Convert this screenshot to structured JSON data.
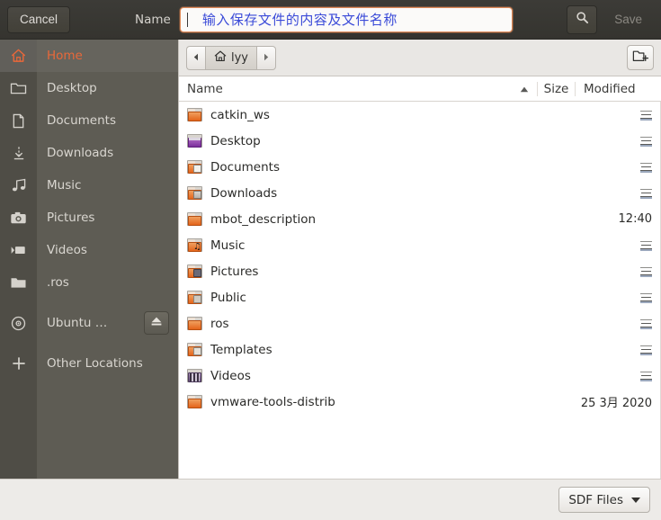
{
  "header": {
    "cancel_label": "Cancel",
    "name_label": "Name",
    "name_value": "",
    "name_annotation": "输入保存文件的内容及文件名称",
    "search_icon": "search-icon",
    "save_label": "Save",
    "save_enabled": false
  },
  "sidebar": {
    "items": [
      {
        "label": "Home",
        "icon": "home-icon",
        "selected": true
      },
      {
        "label": "Desktop",
        "icon": "folder-icon",
        "selected": false
      },
      {
        "label": "Documents",
        "icon": "document-icon",
        "selected": false
      },
      {
        "label": "Downloads",
        "icon": "download-icon",
        "selected": false
      },
      {
        "label": "Music",
        "icon": "music-icon",
        "selected": false
      },
      {
        "label": "Pictures",
        "icon": "camera-icon",
        "selected": false
      },
      {
        "label": "Videos",
        "icon": "video-icon",
        "selected": false
      },
      {
        "label": ".ros",
        "icon": "folder-icon",
        "selected": false
      },
      {
        "label": "Ubuntu …",
        "icon": "disc-icon",
        "selected": false,
        "eject": true,
        "eject_icon": "eject-icon"
      },
      {
        "label": "Other Locations",
        "icon": "plus-icon",
        "selected": false
      }
    ]
  },
  "pathbar": {
    "back_icon": "chevron-left-icon",
    "forward_icon": "chevron-right-icon",
    "crumbs": [
      {
        "label": "lyy",
        "icon": "home-icon",
        "active": true
      }
    ],
    "new_folder_icon": "new-folder-icon"
  },
  "columns": {
    "name": "Name",
    "size": "Size",
    "modified": "Modified",
    "sort_column": "Name",
    "sort_direction": "ascending",
    "sort_icon": "triangle-up-icon"
  },
  "files": [
    {
      "name": "catkin_ws",
      "icon": "folder-icon",
      "size": "",
      "modified": "≡"
    },
    {
      "name": "Desktop",
      "icon": "folder-desktop-icon",
      "size": "",
      "modified": "≡"
    },
    {
      "name": "Documents",
      "icon": "folder-documents-icon",
      "size": "",
      "modified": "≡"
    },
    {
      "name": "Downloads",
      "icon": "folder-downloads-icon",
      "size": "",
      "modified": "≡"
    },
    {
      "name": "mbot_description",
      "icon": "folder-icon",
      "size": "",
      "modified": "12:40"
    },
    {
      "name": "Music",
      "icon": "folder-music-icon",
      "size": "",
      "modified": "≡"
    },
    {
      "name": "Pictures",
      "icon": "folder-pictures-icon",
      "size": "",
      "modified": "≡"
    },
    {
      "name": "Public",
      "icon": "folder-public-icon",
      "size": "",
      "modified": "≡"
    },
    {
      "name": "ros",
      "icon": "folder-icon",
      "size": "",
      "modified": "≡"
    },
    {
      "name": "Templates",
      "icon": "folder-templates-icon",
      "size": "",
      "modified": "≡"
    },
    {
      "name": "Videos",
      "icon": "folder-videos-icon",
      "size": "",
      "modified": "≡"
    },
    {
      "name": "vmware-tools-distrib",
      "icon": "folder-icon",
      "size": "",
      "modified": "25 3月 2020"
    }
  ],
  "footer": {
    "filter_label": "SDF Files",
    "filter_caret_icon": "caret-down-icon"
  },
  "colors": {
    "headerbar": "#3a3934",
    "sidebar": "#5e5c54",
    "sidebar_strip": "#4f4d46",
    "accent_orange": "#e8683a",
    "entry_focus_border": "#e08a58",
    "annotation_blue": "#3a4ad8",
    "footer": "#edebe8"
  }
}
